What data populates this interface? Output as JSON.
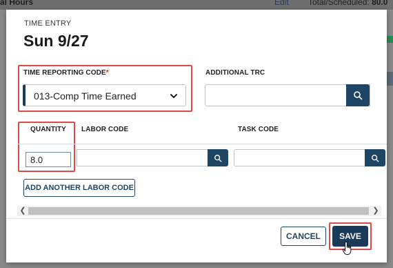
{
  "background": {
    "page_title": "al Hours",
    "edit_link": "Edit",
    "total_label": "Total/Scheduled:",
    "total_value": "80.0"
  },
  "modal": {
    "eyebrow": "TIME ENTRY",
    "title": "Sun 9/27",
    "trc": {
      "label": "TIME REPORTING CODE",
      "required_marker": "*",
      "value": "013-Comp Time Earned"
    },
    "additional_trc": {
      "label": "ADDITIONAL TRC",
      "value": ""
    },
    "grid": {
      "quantity_label": "QUANTITY",
      "labor_code_label": "LABOR CODE",
      "task_code_label": "TASK CODE",
      "quantity_value": "8.0",
      "labor_code_value": "",
      "task_code_value": ""
    },
    "add_labor_code_button": "ADD ANOTHER LABOR CODE",
    "cancel_button": "CANCEL",
    "save_button": "SAVE"
  },
  "icons": {
    "search": "search-icon",
    "chevron": "chevron-down-icon",
    "cursor": "hand-pointer-icon"
  },
  "colors": {
    "primary": "#1b3a57",
    "highlight": "#e04848",
    "required": "#d8242a"
  }
}
